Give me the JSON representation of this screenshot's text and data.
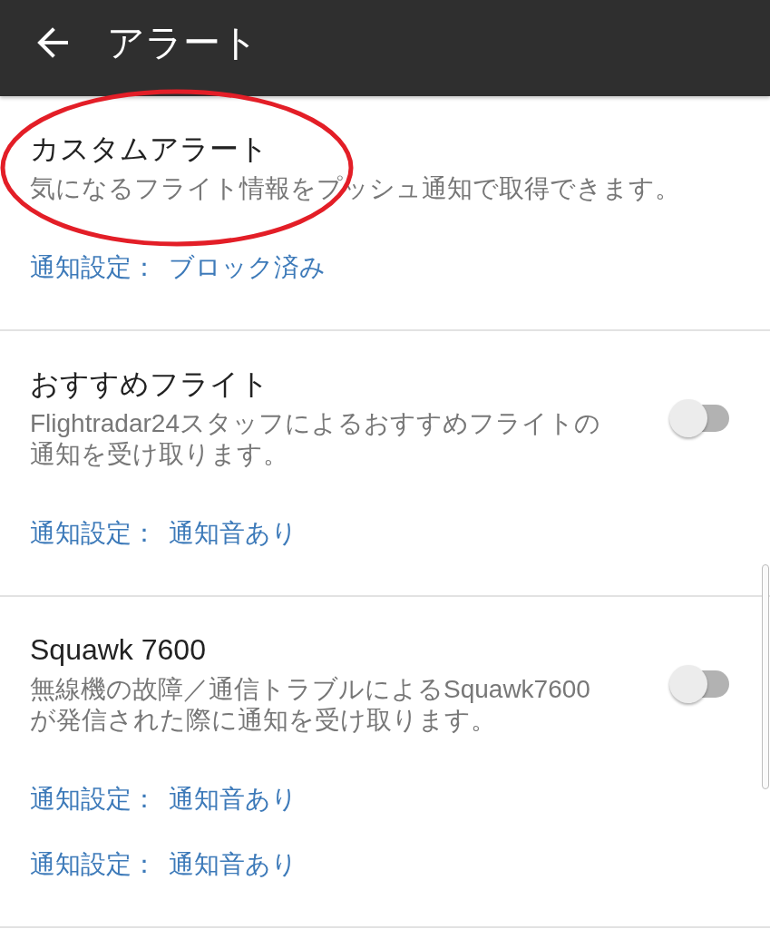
{
  "app_bar": {
    "title": "アラート"
  },
  "annotation": {
    "kind": "ellipse"
  },
  "sections": [
    {
      "title": "カスタムアラート",
      "description": "気になるフライト情報をプッシュ通知で取得できます。",
      "settings": [
        {
          "label": "通知設定：",
          "value": "ブロック済み"
        }
      ]
    },
    {
      "title": "おすすめフライト",
      "description": "Flightradar24スタッフによるおすすめフライトの通知を受け取ります。",
      "toggle": {
        "on": false
      },
      "settings": [
        {
          "label": "通知設定：",
          "value": "通知音あり"
        }
      ]
    },
    {
      "title": "Squawk 7600",
      "description": "無線機の故障／通信トラブルによるSquawk7600が発信された際に通知を受け取ります。",
      "toggle": {
        "on": false
      },
      "settings": [
        {
          "label": "通知設定：",
          "value": "通知音あり"
        },
        {
          "label": "通知設定：",
          "value": "通知音あり"
        }
      ]
    }
  ]
}
